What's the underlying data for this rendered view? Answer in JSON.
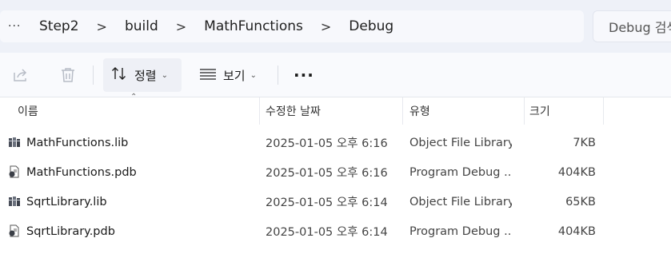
{
  "breadcrumb": {
    "more": "···",
    "items": [
      "Step2",
      "build",
      "MathFunctions",
      "Debug"
    ],
    "separator": ">"
  },
  "search": {
    "placeholder": "Debug 검색"
  },
  "toolbar": {
    "share_icon": "share-icon",
    "delete_icon": "trash-icon",
    "sort_label": "정렬",
    "view_label": "보기",
    "more_label": "···"
  },
  "columns": {
    "name": "이름",
    "date": "수정한 날짜",
    "type": "유형",
    "size": "크기"
  },
  "files": [
    {
      "name": "MathFunctions.lib",
      "date": "2025-01-05 오후 6:16",
      "type": "Object File Library",
      "size": "7KB",
      "icon": "library-file-icon"
    },
    {
      "name": "MathFunctions.pdb",
      "date": "2025-01-05 오후 6:16",
      "type": "Program Debug ...",
      "size": "404KB",
      "icon": "debug-file-icon"
    },
    {
      "name": "SqrtLibrary.lib",
      "date": "2025-01-05 오후 6:14",
      "type": "Object File Library",
      "size": "65KB",
      "icon": "library-file-icon"
    },
    {
      "name": "SqrtLibrary.pdb",
      "date": "2025-01-05 오후 6:14",
      "type": "Program Debug ...",
      "size": "404KB",
      "icon": "debug-file-icon"
    }
  ]
}
